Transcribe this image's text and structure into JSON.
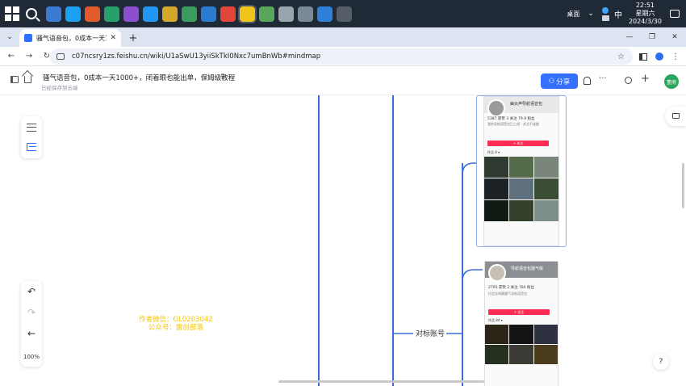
{
  "taskbar": {
    "apps": [
      "app-1",
      "app-2",
      "app-3",
      "app-4",
      "app-5",
      "app-6",
      "app-7",
      "app-8",
      "app-9",
      "app-10",
      "app-11",
      "app-12",
      "app-13",
      "app-14",
      "app-15",
      "app-16"
    ],
    "app_colors": [
      "#3b7bd4",
      "#1ca0f2",
      "#e15b2a",
      "#27a06a",
      "#8b4fd0",
      "#2196f3",
      "#d4a82a",
      "#3a9d5d",
      "#2a7bd0",
      "#e2463b",
      "#f0c419",
      "#5aa65a",
      "#9aa4ae",
      "#7b8a99",
      "#2f7fd8",
      "#555e66"
    ],
    "tray_desktop_label": "桌面",
    "ime": "中",
    "time": "22:51",
    "weekday": "星期六",
    "date": "2024/3/30"
  },
  "browser": {
    "tab_title": "骚气语音包，0成本一天1000+，闭着眼也能出单，保姆级教程",
    "url": "c07ncsry1zs.feishu.cn/wiki/U1aSwU13yiiSkTkI0Nxc7umBnWb#mindmap"
  },
  "doc": {
    "title": "骚气语音包，0成本一天1000+，闭着眼也能出单，保姆级教程",
    "saved_status": "已经保存到云端",
    "share_label": "分享",
    "avatar_text": "董雨"
  },
  "canvas": {
    "zoom": "100%",
    "watermark_line1": "作者微信：GL0203042",
    "watermark_line2": "公众号：雷创部落",
    "node_label": "对标账号",
    "profile1": {
      "name": "幽女声导航语音包",
      "stats": "5387 获赞   3 关注   79.9 粉丝",
      "bio": "我的导航语音包已上线 · 关注不迷路",
      "follow": "+ 关注",
      "tab": "作品 8 ▾"
    },
    "profile2": {
      "name": "导航语音包骚气版",
      "stats": "2705 获赞   2 关注   784 粉丝",
      "bio": "打造全网最骚气导航语音包",
      "follow": "+ 关注",
      "tab": "作品 84 ▾"
    }
  }
}
